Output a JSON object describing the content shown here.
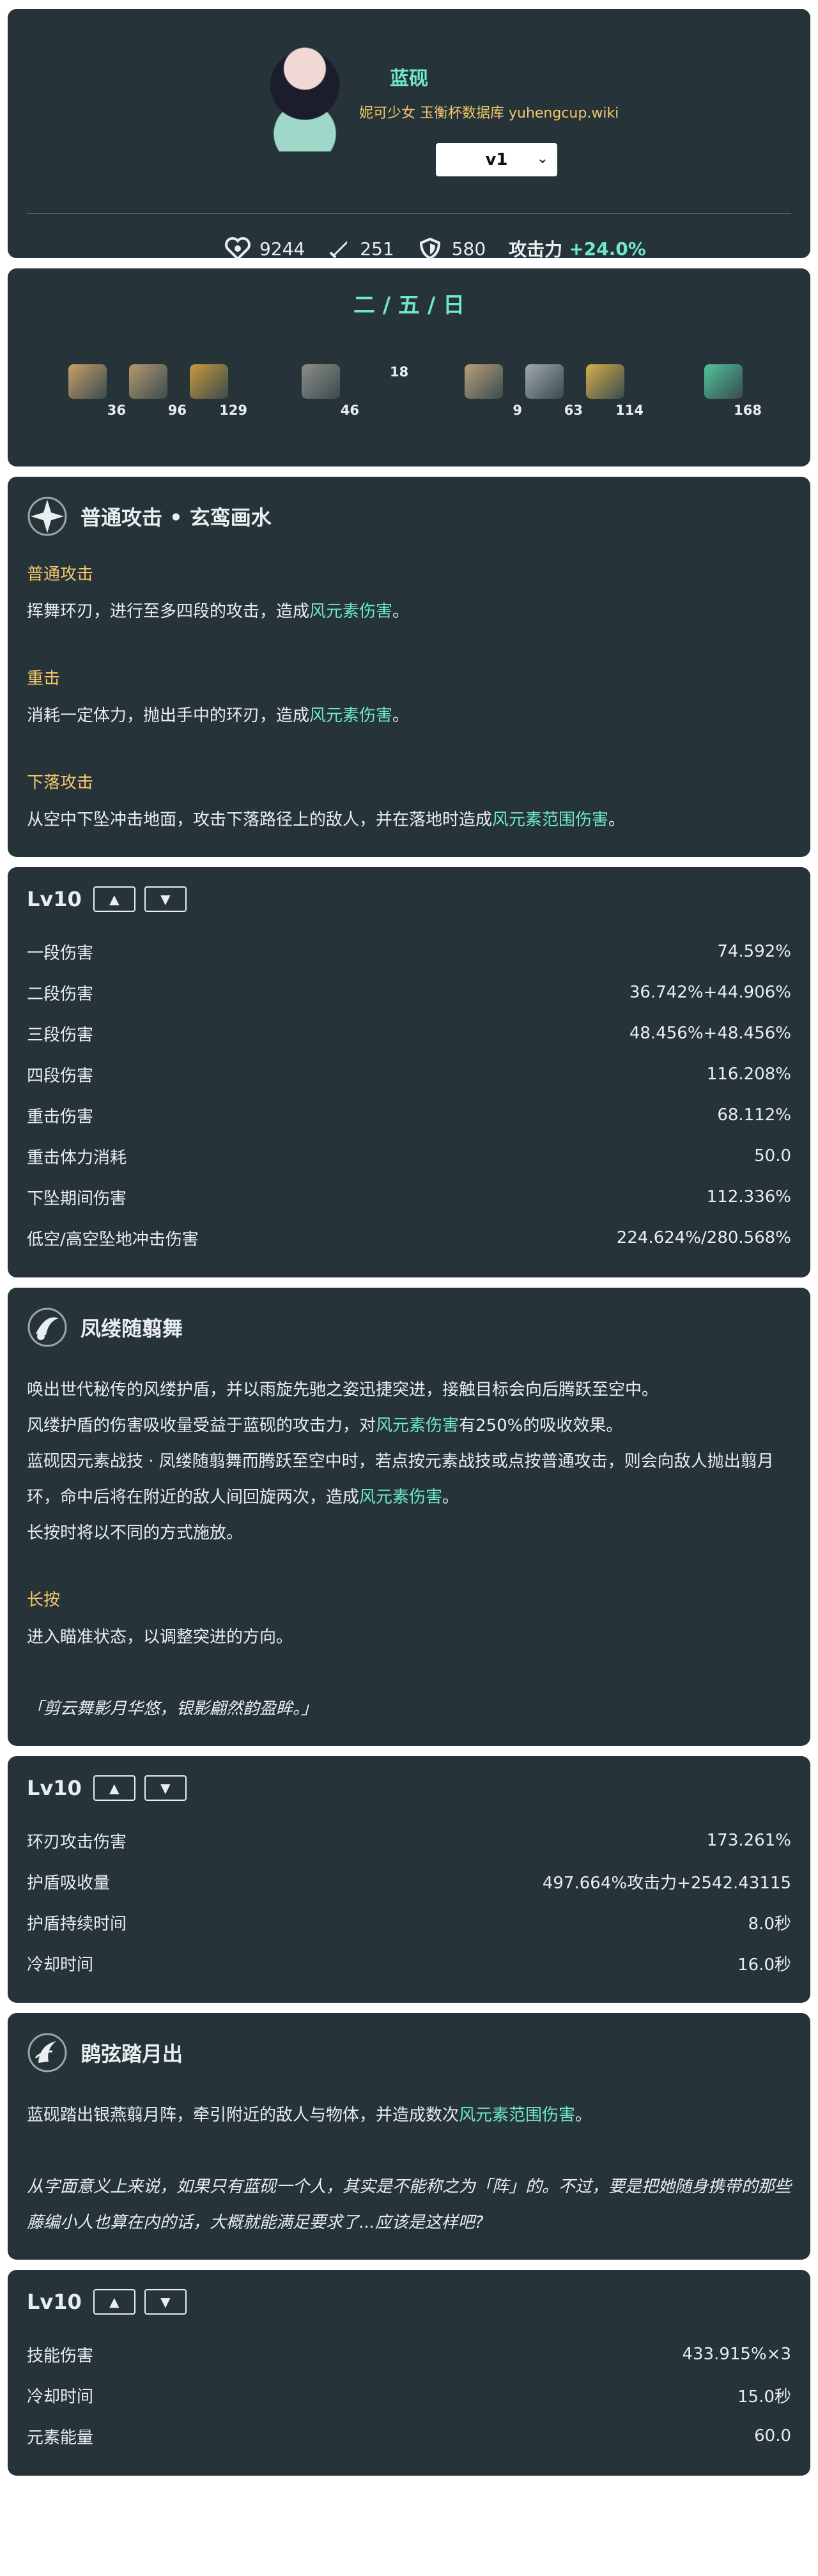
{
  "header": {
    "name": "蓝砚",
    "subtitle": "妮可少女 玉衡杯数据库 yuhengcup.wiki",
    "version": "v1",
    "stats": {
      "hp": "9244",
      "atk": "251",
      "def": "580",
      "bonus_label": "攻击力",
      "bonus_value": "+24.0%"
    }
  },
  "materials": {
    "days": "二 / 五 / 日",
    "items": [
      {
        "count": "36",
        "color": "#c8a064",
        "icon": "gem-icon"
      },
      {
        "count": "96",
        "color": "#b49a6e",
        "icon": "horn-icon"
      },
      {
        "count": "129",
        "color": "#c89a3a",
        "icon": "crown-icon"
      },
      {
        "count": "46",
        "color": "#8e8e86",
        "icon": "gear-icon"
      },
      {
        "count": "9",
        "color": "#b8a078",
        "icon": "scroll-icon"
      },
      {
        "count": "63",
        "color": "#a0a8b0",
        "icon": "scroll-icon"
      },
      {
        "count": "114",
        "color": "#d4b04a",
        "icon": "scroll-icon"
      },
      {
        "count": "168",
        "color": "#4fc59a",
        "icon": "leaf-icon"
      }
    ],
    "floating": "18"
  },
  "skill1": {
    "title": "普通攻击 • 玄鸾画水",
    "s1_label": "普通攻击",
    "s1_pre": "挥舞环刃，进行至多四段的攻击，造成",
    "s1_hl": "风元素伤害",
    "s1_post": "。",
    "s2_label": "重击",
    "s2_pre": "消耗一定体力，抛出手中的环刃，造成",
    "s2_hl": "风元素伤害",
    "s2_post": "。",
    "s3_label": "下落攻击",
    "s3_pre": "从空中下坠冲击地面，攻击下落路径上的敌人，并在落地时造成",
    "s3_hl": "风元素范围伤害",
    "s3_post": "。"
  },
  "table1": {
    "level": "Lv10",
    "up": "▲",
    "down": "▼",
    "rows": [
      {
        "label": "一段伤害",
        "value": "74.592%"
      },
      {
        "label": "二段伤害",
        "value": "36.742%+44.906%"
      },
      {
        "label": "三段伤害",
        "value": "48.456%+48.456%"
      },
      {
        "label": "四段伤害",
        "value": "116.208%"
      },
      {
        "label": "重击伤害",
        "value": "68.112%"
      },
      {
        "label": "重击体力消耗",
        "value": "50.0"
      },
      {
        "label": "下坠期间伤害",
        "value": "112.336%"
      },
      {
        "label": "低空/高空坠地冲击伤害",
        "value": "224.624%/280.568%"
      }
    ]
  },
  "skill2": {
    "title": "凤缕随翦舞",
    "p1": "唤出世代秘传的风缕护盾，并以雨旋先驰之姿迅捷突进，接触目标会向后腾跃至空中。",
    "p2_pre": "风缕护盾的伤害吸收量受益于蓝砚的攻击力，对",
    "p2_hl": "风元素伤害",
    "p2_post": "有250%的吸收效果。",
    "p3_pre": "蓝砚因元素战技 · 凤缕随翦舞而腾跃至空中时，若点按元素战技或点按普通攻击，则会向敌人抛出翦月环，命中后将在附近的敌人间回旋两次，造成",
    "p3_hl": "风元素伤害",
    "p3_post": "。",
    "p4": "长按时将以不同的方式施放。",
    "hold_label": "长按",
    "hold_text": "进入瞄准状态，以调整突进的方向。",
    "quote": "「剪云舞影月华悠，银影翩然韵盈眸。」"
  },
  "table2": {
    "level": "Lv10",
    "up": "▲",
    "down": "▼",
    "rows": [
      {
        "label": "环刃攻击伤害",
        "value": "173.261%"
      },
      {
        "label": "护盾吸收量",
        "value": "497.664%攻击力+2542.43115"
      },
      {
        "label": "护盾持续时间",
        "value": "8.0秒"
      },
      {
        "label": "冷却时间",
        "value": "16.0秒"
      }
    ]
  },
  "skill3": {
    "title": "鹍弦踏月出",
    "p1_pre": "蓝砚踏出银燕翦月阵，牵引附近的敌人与物体，并造成数次",
    "p1_hl": "风元素范围伤害",
    "p1_post": "。",
    "quote": "从字面意义上来说，如果只有蓝砚一个人，其实是不能称之为「阵」的。不过，要是把她随身携带的那些藤编小人也算在内的话，大概就能满足要求了...应该是这样吧?"
  },
  "table3": {
    "level": "Lv10",
    "up": "▲",
    "down": "▼",
    "rows": [
      {
        "label": "技能伤害",
        "value": "433.915%×3"
      },
      {
        "label": "冷却时间",
        "value": "15.0秒"
      },
      {
        "label": "元素能量",
        "value": "60.0"
      }
    ]
  },
  "colors": {
    "card": "#263339",
    "accent": "#6ee8c6",
    "label": "#f2c86a"
  }
}
